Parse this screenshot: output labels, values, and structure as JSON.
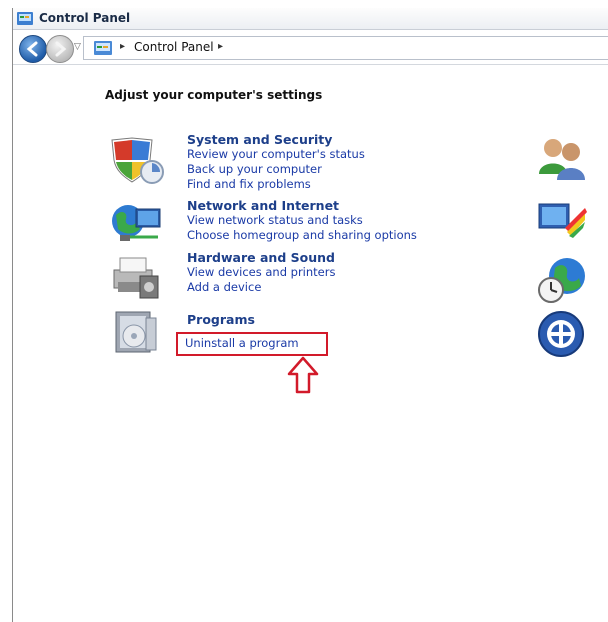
{
  "window": {
    "title": "Control Panel"
  },
  "address_bar": {
    "breadcrumb": "Control Panel"
  },
  "main": {
    "heading": "Adjust your computer's settings",
    "categories": [
      {
        "title": "System and Security",
        "links": [
          "Review your computer's status",
          "Back up your computer",
          "Find and fix problems"
        ],
        "icon": "shield-icon"
      },
      {
        "title": "Network and Internet",
        "links": [
          "View network status and tasks",
          "Choose homegroup and sharing options"
        ],
        "icon": "network-icon"
      },
      {
        "title": "Hardware and Sound",
        "links": [
          "View devices and printers",
          "Add a device"
        ],
        "icon": "printer-icon"
      },
      {
        "title": "Programs",
        "links": [
          "Uninstall a program"
        ],
        "icon": "programs-icon"
      }
    ],
    "right_icons": [
      "user-accounts-icon",
      "appearance-icon",
      "clock-globe-icon",
      "ease-of-access-icon"
    ]
  },
  "annotation": {
    "highlight_color": "#d21a2a"
  }
}
